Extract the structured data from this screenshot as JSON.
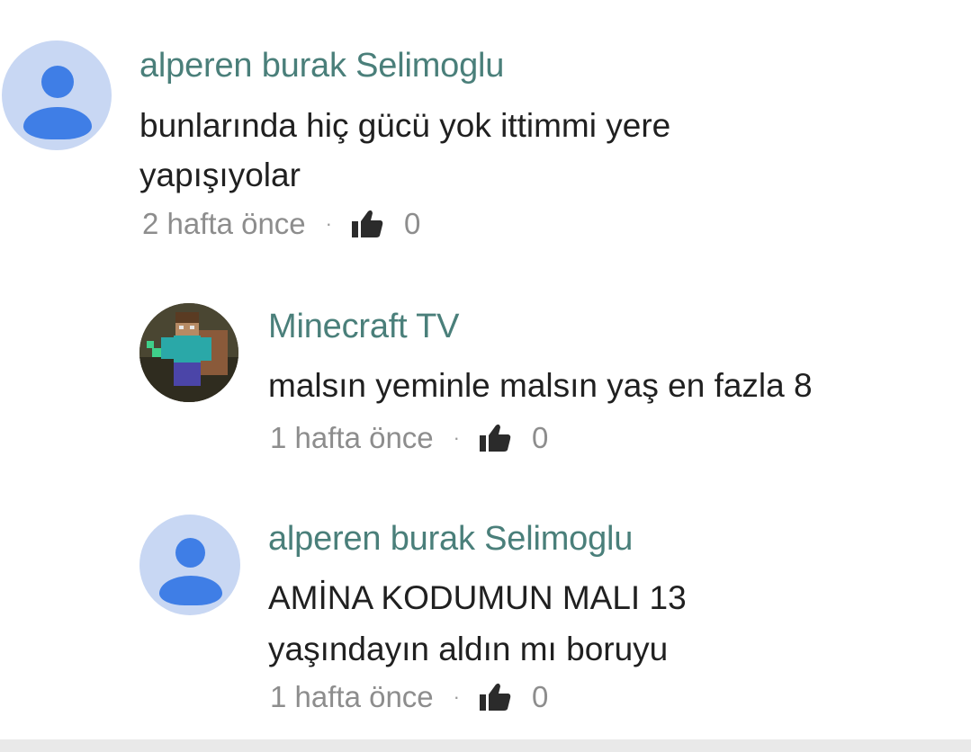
{
  "comments": [
    {
      "author": "alperen burak Selimoglu",
      "lines": [
        "bunlarında hiç gücü yok ittimmi yere",
        "yapışıyolar"
      ],
      "time": "2 hafta önce",
      "separator": "·",
      "likes": "0",
      "avatar": "default-user-icon"
    },
    {
      "author": "Minecraft TV",
      "lines": [
        "malsın yeminle malsın yaş en fazla 8"
      ],
      "time": "1 hafta önce",
      "separator": "·",
      "likes": "0",
      "avatar": "minecraft-character-avatar"
    },
    {
      "author": "alperen burak Selimoglu",
      "lines": [
        "AMİNA KODUMUN MALI 13",
        "yaşındayın aldın mı boruyu"
      ],
      "time": "1 hafta önce",
      "separator": "·",
      "likes": "0",
      "avatar": "default-user-icon"
    }
  ],
  "colors": {
    "author": "#4a7f7a",
    "avatar_bg": "#c8d7f3",
    "avatar_fg": "#3f7ee6",
    "meta": "#8d8d8d"
  }
}
